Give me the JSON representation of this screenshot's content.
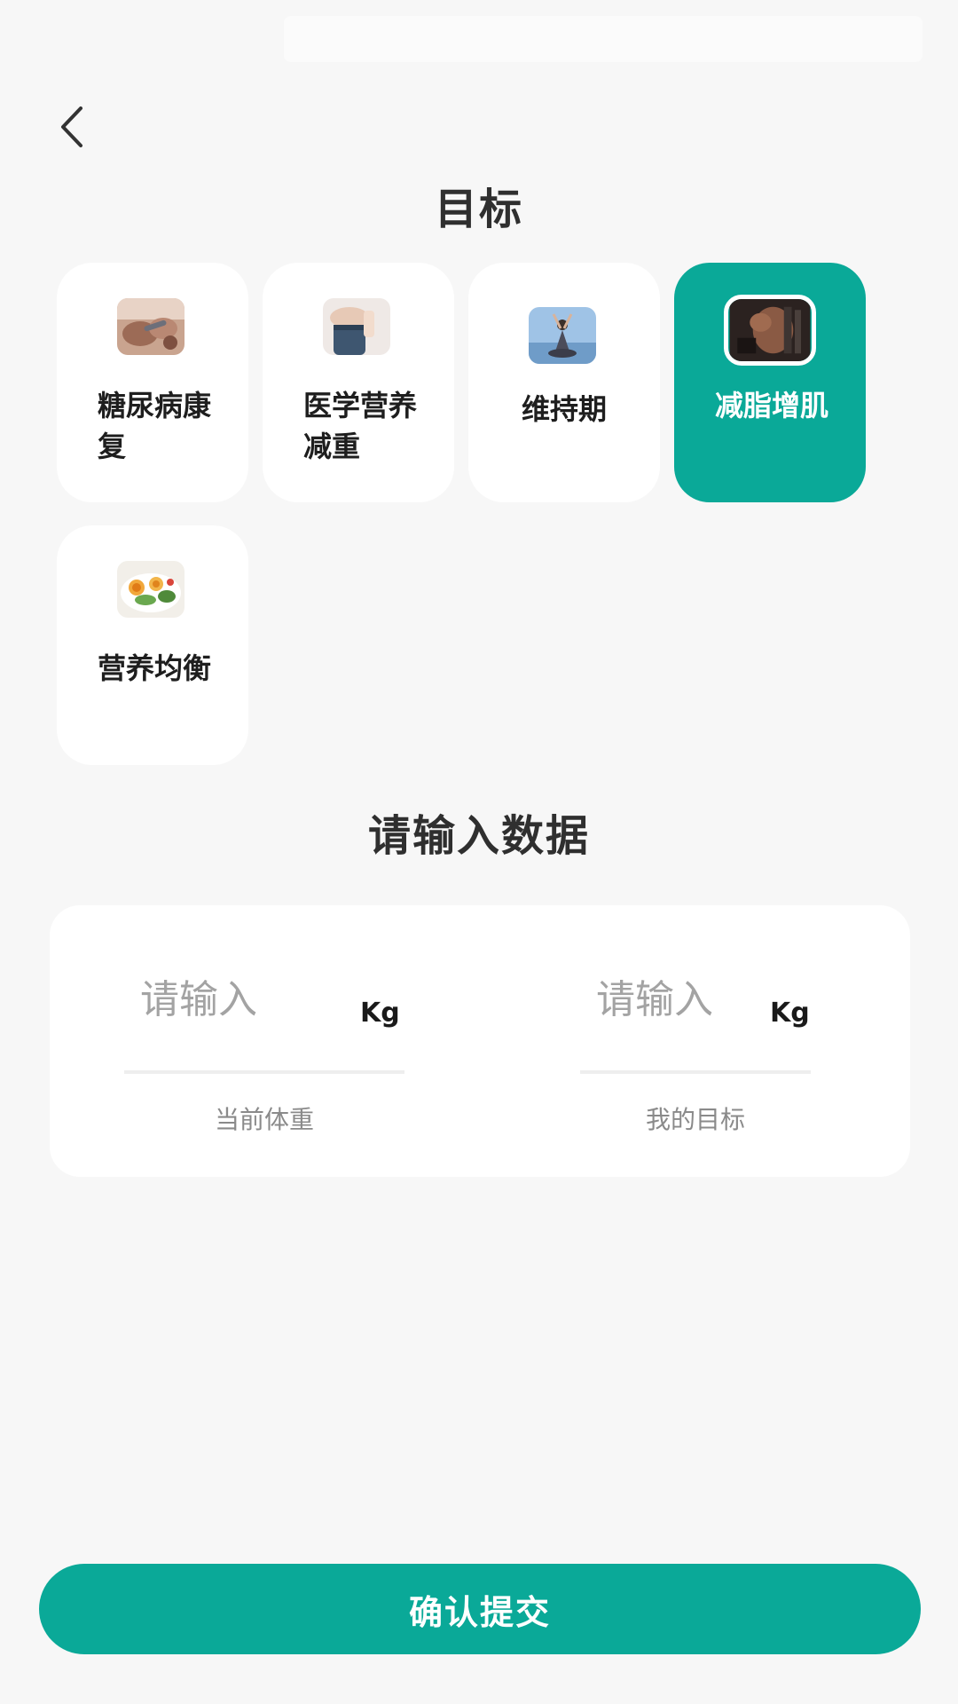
{
  "header": {
    "back_icon": "chevron-left-icon",
    "title": "目标"
  },
  "goals": [
    {
      "id": "diabetes",
      "label": "糖尿病康复",
      "image": "diabetes-care-photo",
      "selected": false
    },
    {
      "id": "medical",
      "label": "医学营养减重",
      "image": "weight-loss-photo",
      "selected": false
    },
    {
      "id": "maintain",
      "label": "维持期",
      "image": "yoga-photo",
      "selected": false
    },
    {
      "id": "fatloss",
      "label": "减脂增肌",
      "image": "fitness-photo",
      "selected": true
    },
    {
      "id": "balance",
      "label": "营养均衡",
      "image": "healthy-food-photo",
      "selected": false
    }
  ],
  "data_section": {
    "title": "请输入数据",
    "current_weight": {
      "placeholder": "请输入",
      "unit": "Kg",
      "caption": "当前体重",
      "value": ""
    },
    "target_weight": {
      "placeholder": "请输入",
      "unit": "Kg",
      "caption": "我的目标",
      "value": ""
    }
  },
  "submit": {
    "label": "确认提交"
  },
  "colors": {
    "accent": "#0aa998",
    "background": "#f7f7f7",
    "card": "#ffffff"
  }
}
